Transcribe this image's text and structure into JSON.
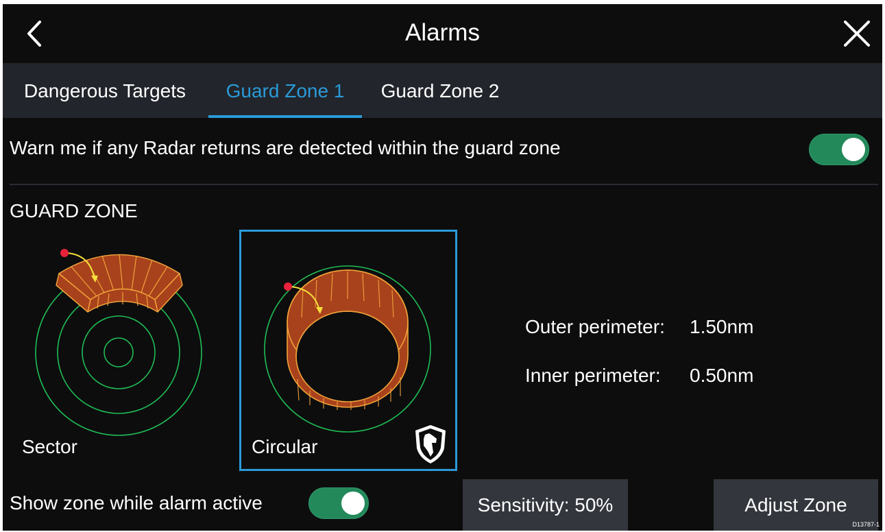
{
  "header": {
    "title": "Alarms",
    "back_icon": "chevron-left-icon",
    "close_icon": "close-icon"
  },
  "tabs": [
    {
      "label": "Dangerous Targets",
      "active": false
    },
    {
      "label": "Guard Zone 1",
      "active": true
    },
    {
      "label": "Guard Zone 2",
      "active": false
    }
  ],
  "warn": {
    "label": "Warn me if any Radar returns are detected within the guard zone",
    "enabled": true
  },
  "guard_zone": {
    "section_label": "GUARD ZONE",
    "options": [
      {
        "label": "Sector",
        "selected": false
      },
      {
        "label": "Circular",
        "selected": true,
        "badge_icon": "guard-dog-shield-icon"
      }
    ],
    "outer_perimeter": {
      "label": "Outer perimeter:",
      "value": "1.50nm"
    },
    "inner_perimeter": {
      "label": "Inner perimeter:",
      "value": "0.50nm"
    }
  },
  "bottom": {
    "show_zone_label": "Show zone while alarm active",
    "show_zone_enabled": true,
    "sensitivity_label": "Sensitivity: 50%",
    "adjust_zone_label": "Adjust Zone"
  },
  "doc_code": "D13787-1",
  "colors": {
    "background": "#0d0d0e",
    "tab_bar": "#22252b",
    "accent_blue": "#2a9bd8",
    "toggle_green": "#23895a",
    "ring_green": "#1fbf55",
    "zone_fill": "#a8421c",
    "zone_stroke": "#f0a23a",
    "marker_red": "#e8223a",
    "arrow_yellow": "#f5e03a",
    "button_bg": "#33363d"
  }
}
